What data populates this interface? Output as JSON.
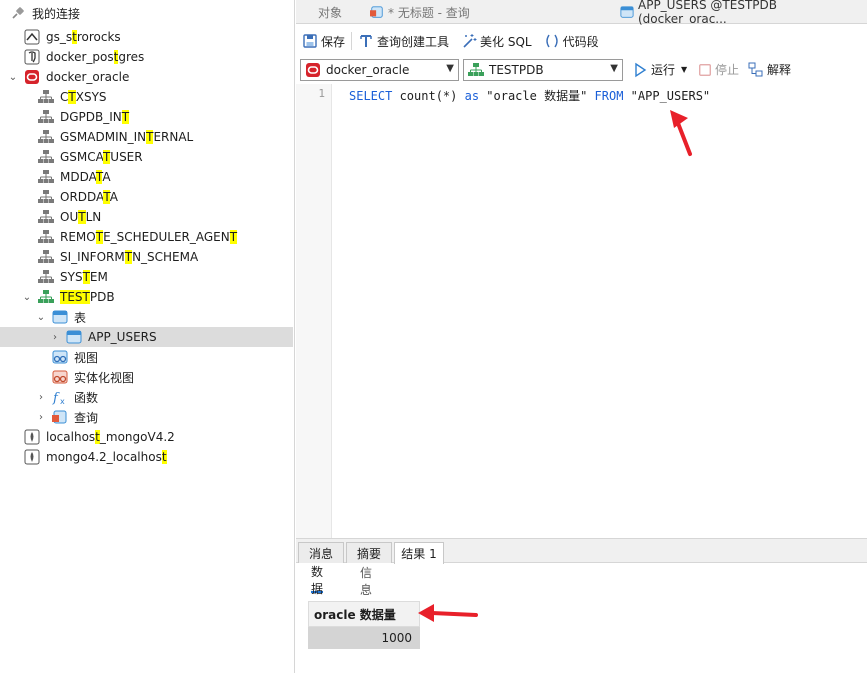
{
  "tree": {
    "root_label": "我的连接",
    "connections": [
      {
        "label_pre": "gs_s",
        "label_hl": "t",
        "label_post": "rorocks"
      },
      {
        "label_pre": "docker_pos",
        "label_hl": "t",
        "label_post": "gres"
      },
      {
        "label_pre": "docker_oracle",
        "label_hl": "",
        "label_post": ""
      }
    ],
    "schemas": [
      {
        "pre": "C",
        "hl": "T",
        "post": "XSYS"
      },
      {
        "pre": "DGPDB_IN",
        "hl": "T",
        "post": ""
      },
      {
        "pre": "GSMADMIN_IN",
        "hl": "T",
        "post": "ERNAL"
      },
      {
        "pre": "GSMCA",
        "hl": "T",
        "post": "USER"
      },
      {
        "pre": "MDDA",
        "hl": "T",
        "post": "A"
      },
      {
        "pre": "ORDDA",
        "hl": "T",
        "post": "A"
      },
      {
        "pre": "OU",
        "hl": "T",
        "post": "LN"
      },
      {
        "pre": "REMO",
        "hl": "T",
        "post": "E_SCHEDULER_AGEN"
      },
      {
        "pre": "SI_INFORM",
        "hl": "T",
        "post": "N_SCHEMA"
      },
      {
        "pre": "SYS",
        "hl": "T",
        "post": "EM"
      }
    ],
    "remote_tail_hl": "T",
    "testpdb": {
      "pre": "",
      "hl": "TEST",
      "mid": "",
      "hl2": "",
      "post": "PDB"
    },
    "tables_label": "表",
    "app_users_label": "APP_USERS",
    "views_label": "视图",
    "mat_views_label": "实体化视图",
    "functions_label": "函数",
    "queries_label": "查询",
    "mongo1": {
      "pre": "localhos",
      "hl": "t",
      "post": "_mongoV4.2"
    },
    "mongo2": {
      "pre": "mongo4.2_localhos",
      "hl": "t",
      "post": ""
    }
  },
  "tabs": {
    "objects": "对象",
    "untitled": "* 无标题 - 查询",
    "app_users": "APP_USERS @TESTPDB (docker_orac..."
  },
  "toolbar": {
    "save": "保存",
    "query_builder": "查询创建工具",
    "beautify": "美化 SQL",
    "snippet": "代码段"
  },
  "selectors": {
    "connection": "docker_oracle",
    "database": "TESTPDB",
    "run": "运行",
    "stop": "停止",
    "explain": "解释"
  },
  "editor": {
    "line_number": "1",
    "kw_select": "SELECT",
    "fn_count": " count(*) ",
    "kw_as": "as",
    "alias": " \"oracle 数据量\" ",
    "kw_from": "FROM",
    "table": " \"APP_USERS\""
  },
  "result": {
    "tabs": [
      "消息",
      "摘要",
      "结果 1"
    ],
    "subtabs": [
      "数据",
      "信息"
    ],
    "column_header": "oracle 数据量",
    "cell_value": "1000"
  },
  "colors": {
    "accent": "#1a73d8",
    "keyword": "#1a5fd8",
    "highlight": "#ffff00",
    "arrow": "#e8202a",
    "oracle_red": "#d6232b",
    "schema_green": "#3aa05a"
  }
}
